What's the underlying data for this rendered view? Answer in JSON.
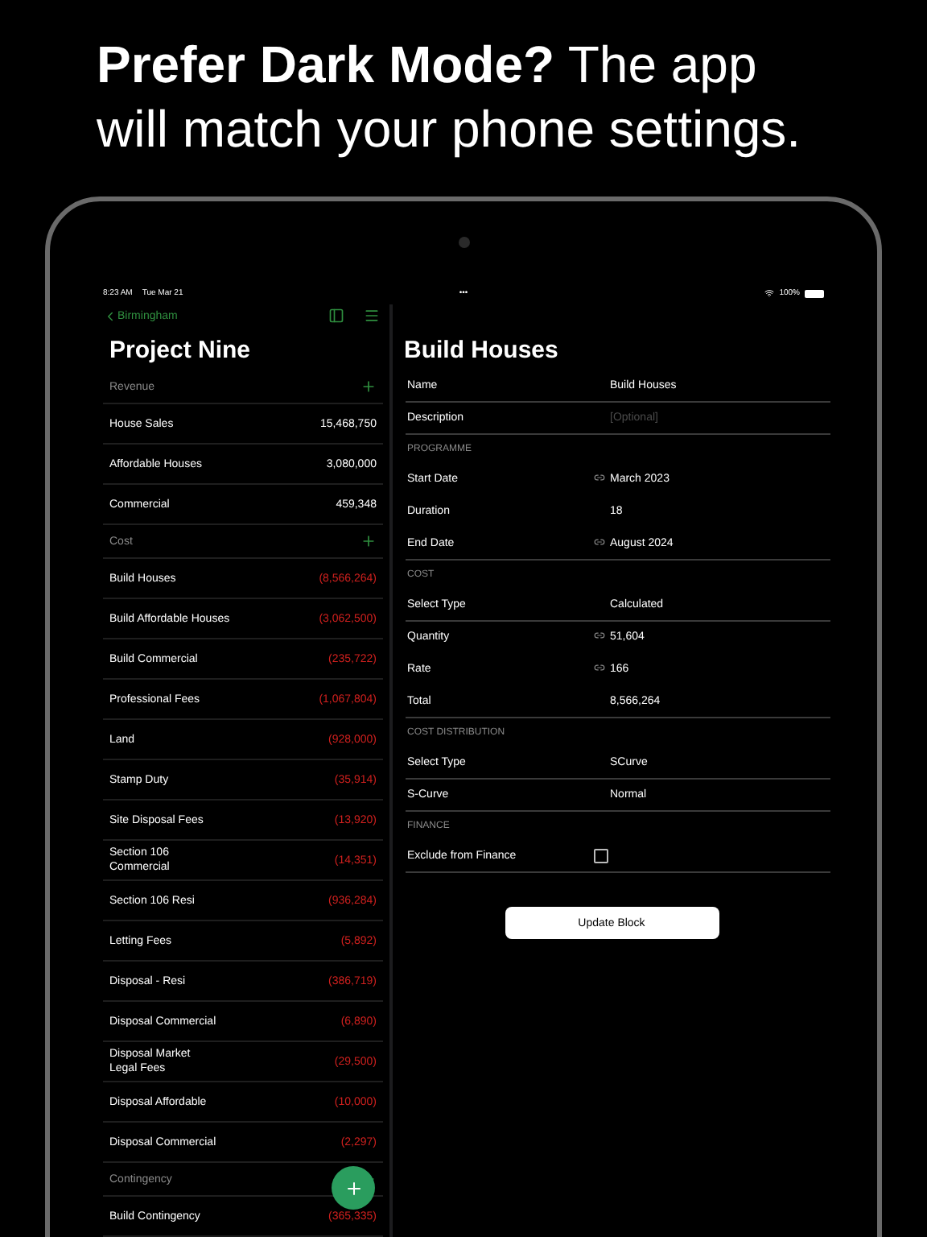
{
  "headline": "**Prefer Dark Mode?** The app will match your phone settings.",
  "status_bar": {
    "time": "8:23 AM",
    "date": "Tue Mar 21",
    "dots": "•••",
    "battery": "100%"
  },
  "sidebar": {
    "back": "Birmingham",
    "title": "Project Nine",
    "sections": [
      {
        "title": "Revenue",
        "items": [
          {
            "label": "House Sales",
            "value": "15,468,750",
            "negative": false
          },
          {
            "label": "Affordable Houses",
            "value": "3,080,000",
            "negative": false
          },
          {
            "label": "Commercial",
            "value": "459,348",
            "negative": false
          }
        ]
      },
      {
        "title": "Cost",
        "items": [
          {
            "label": "Build Houses",
            "value": "(8,566,264)",
            "negative": true
          },
          {
            "label": "Build Affordable Houses",
            "value": "(3,062,500)",
            "negative": true
          },
          {
            "label": "Build Commercial",
            "value": "(235,722)",
            "negative": true
          },
          {
            "label": "Professional Fees",
            "value": "(1,067,804)",
            "negative": true
          },
          {
            "label": "Land",
            "value": "(928,000)",
            "negative": true
          },
          {
            "label": "Stamp Duty",
            "value": "(35,914)",
            "negative": true
          },
          {
            "label": "Site Disposal Fees",
            "value": "(13,920)",
            "negative": true
          },
          {
            "label": "Section 106\nCommercial",
            "value": "(14,351)",
            "negative": true
          },
          {
            "label": "Section 106 Resi",
            "value": "(936,284)",
            "negative": true
          },
          {
            "label": "Letting Fees",
            "value": "(5,892)",
            "negative": true
          },
          {
            "label": "Disposal - Resi",
            "value": "(386,719)",
            "negative": true
          },
          {
            "label": "Disposal Commercial",
            "value": "(6,890)",
            "negative": true
          },
          {
            "label": "Disposal Market\nLegal Fees",
            "value": "(29,500)",
            "negative": true
          },
          {
            "label": "Disposal Affordable",
            "value": "(10,000)",
            "negative": true
          },
          {
            "label": "Disposal Commercial",
            "value": "(2,297)",
            "negative": true
          }
        ]
      },
      {
        "title": "Contingency",
        "items": [
          {
            "label": "Build Contingency",
            "value": "(365,335)",
            "negative": true
          }
        ]
      }
    ]
  },
  "detail": {
    "title": "Build Houses",
    "sections": [
      {
        "rows": [
          {
            "label": "Name",
            "value": "Build Houses",
            "kind": "text"
          },
          {
            "label": "Description",
            "placeholder": "[Optional]",
            "kind": "field"
          }
        ]
      },
      {
        "header": "PROGRAMME",
        "rows": [
          {
            "label": "Start Date",
            "value": "March 2023",
            "kind": "linked"
          },
          {
            "label": "Duration",
            "value": "18",
            "kind": "text"
          },
          {
            "label": "End Date",
            "value": "August 2024",
            "kind": "linked"
          }
        ]
      },
      {
        "header": "COST",
        "rows": [
          {
            "label": "Select Type",
            "value": "Calculated",
            "kind": "text"
          },
          {
            "label": "Quantity",
            "value": "51,604",
            "kind": "linked"
          },
          {
            "label": "Rate",
            "value": "166",
            "kind": "linked"
          },
          {
            "label": "Total",
            "value": "8,566,264",
            "kind": "text"
          }
        ]
      },
      {
        "header": "COST DISTRIBUTION",
        "rows": [
          {
            "label": "Select Type",
            "value": "SCurve",
            "kind": "text"
          },
          {
            "label": "S-Curve",
            "value": "Normal",
            "kind": "text"
          }
        ]
      },
      {
        "header": "FINANCE",
        "rows": [
          {
            "label": "Exclude from Finance",
            "kind": "checkbox",
            "checked": false
          }
        ]
      }
    ],
    "button": "Update Block"
  }
}
